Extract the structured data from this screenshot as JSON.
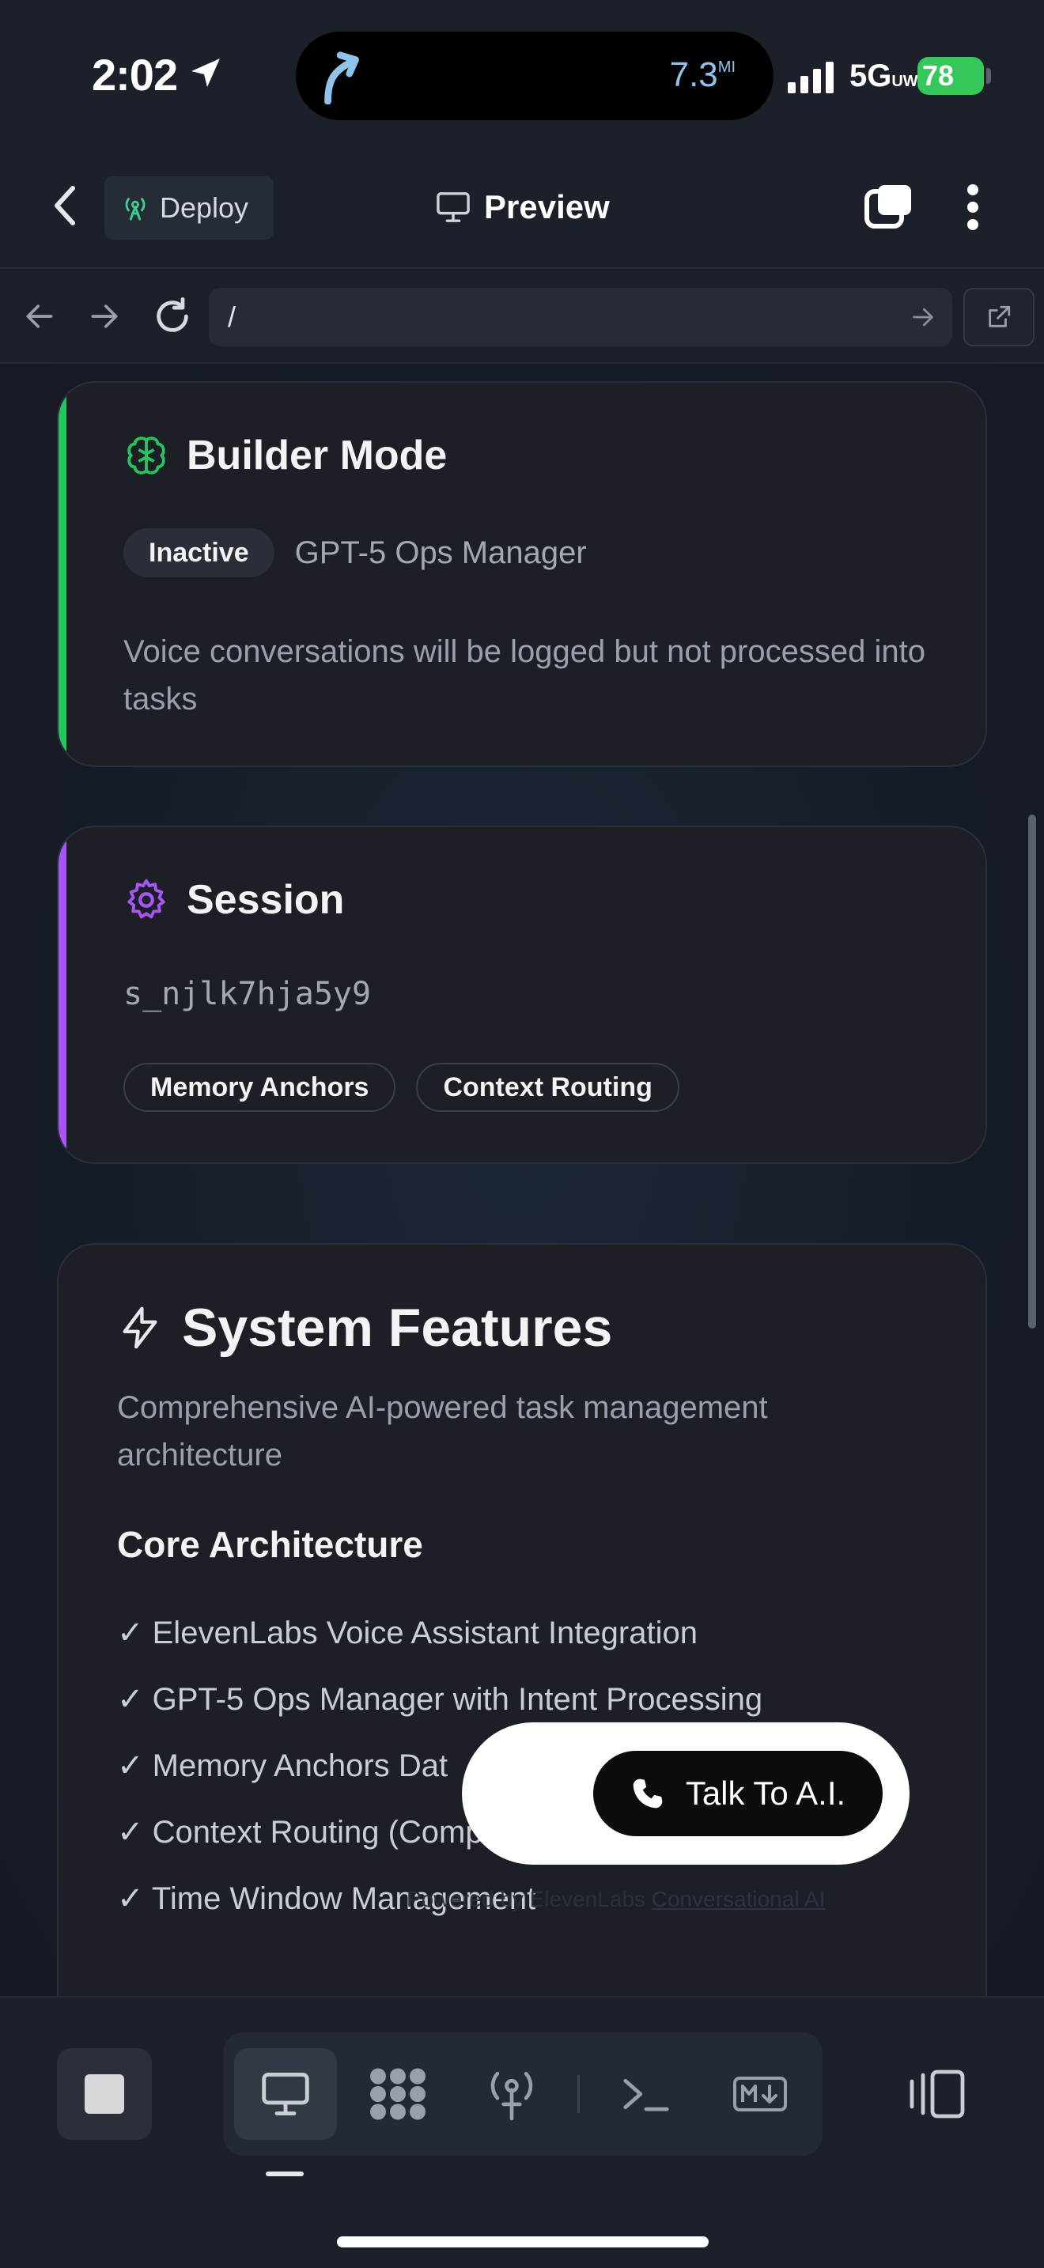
{
  "status_bar": {
    "time": "2:02",
    "nav_distance": "7.3",
    "nav_unit": "MI",
    "network": "5G",
    "network_suffix": "UW",
    "battery": "78"
  },
  "header": {
    "deploy_label": "Deploy",
    "title": "Preview"
  },
  "url_bar": {
    "value": "/"
  },
  "builder_card": {
    "title": "Builder Mode",
    "status_badge": "Inactive",
    "model": "GPT-5 Ops Manager",
    "description": "Voice conversations will be logged but not processed into tasks",
    "accent_color": "#22c55e"
  },
  "session_card": {
    "title": "Session",
    "session_id": "s_njlk7hja5y9",
    "tags": [
      "Memory Anchors",
      "Context Routing"
    ],
    "accent_color": "#a855f7"
  },
  "features_card": {
    "title": "System Features",
    "subtitle": "Comprehensive AI-powered task management architecture",
    "section_title": "Core Architecture",
    "items": [
      "✓ ElevenLabs Voice Assistant Integration",
      "✓ GPT-5 Ops Manager with Intent Processing",
      "✓ Memory Anchors Dat",
      "✓ Context Routing (Comp",
      "✓ Time Window Management"
    ]
  },
  "voice_widget": {
    "button_label": "Talk To A.I.",
    "powered_prefix": "Powered by ElevenLabs",
    "powered_link": "Conversational AI"
  }
}
